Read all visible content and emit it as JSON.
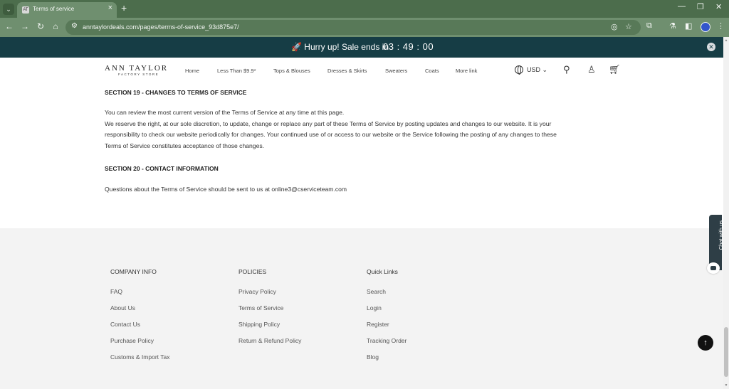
{
  "browser": {
    "tab_title": "Terms of service",
    "tab_favicon": "AT",
    "url": "anntaylordeals.com/pages/terms-of-service_93d875e7/"
  },
  "announcement": {
    "text": "🚀 Hurry up! Sale ends in",
    "timer": "03 : 49 : 00"
  },
  "header": {
    "logo": "ANN TAYLOR",
    "logo_sub": "FACTORY STORE",
    "nav": [
      "Home",
      "Less Than $9.9*",
      "Tops & Blouses",
      "Dresses & Skirts",
      "Sweaters",
      "Coats",
      "More link"
    ],
    "currency": "USD"
  },
  "content": {
    "section19_heading": "SECTION 19 - CHANGES TO TERMS OF SERVICE",
    "section19_lines": [
      "You can review the most current version of the Terms of Service at any time at this page.",
      "We reserve the right, at our sole discretion, to update, change or replace any part of these Terms of Service by posting updates and changes to our website. It is your",
      "responsibility to check our website periodically for changes. Your continued use of or access to our website or the Service following the posting of any changes to these",
      "Terms of Service constitutes acceptance of those changes."
    ],
    "section20_heading": "SECTION 20 - CONTACT INFORMATION",
    "section20_text": "Questions about the Terms of Service should be sent to us at online3@cserviceteam.com"
  },
  "footer": {
    "company": {
      "title": "COMPANY INFO",
      "links": [
        "FAQ",
        "About Us",
        "Contact Us",
        "Purchase Policy",
        "Customs & Import Tax"
      ]
    },
    "policies": {
      "title": "POLICIES",
      "links": [
        "Privacy Policy",
        "Terms of Service",
        "Shipping Policy",
        "Return & Refund Policy"
      ]
    },
    "quick": {
      "title": "Quick Links",
      "links": [
        "Search",
        "Login",
        "Register",
        "Tracking Order",
        "Blog"
      ]
    }
  },
  "widgets": {
    "chat_label": "Chat with us"
  },
  "colors": {
    "announcement_bg": "#163d45",
    "footer_bg": "#f3f3f3",
    "browser_frame": "#6f8f6f"
  }
}
